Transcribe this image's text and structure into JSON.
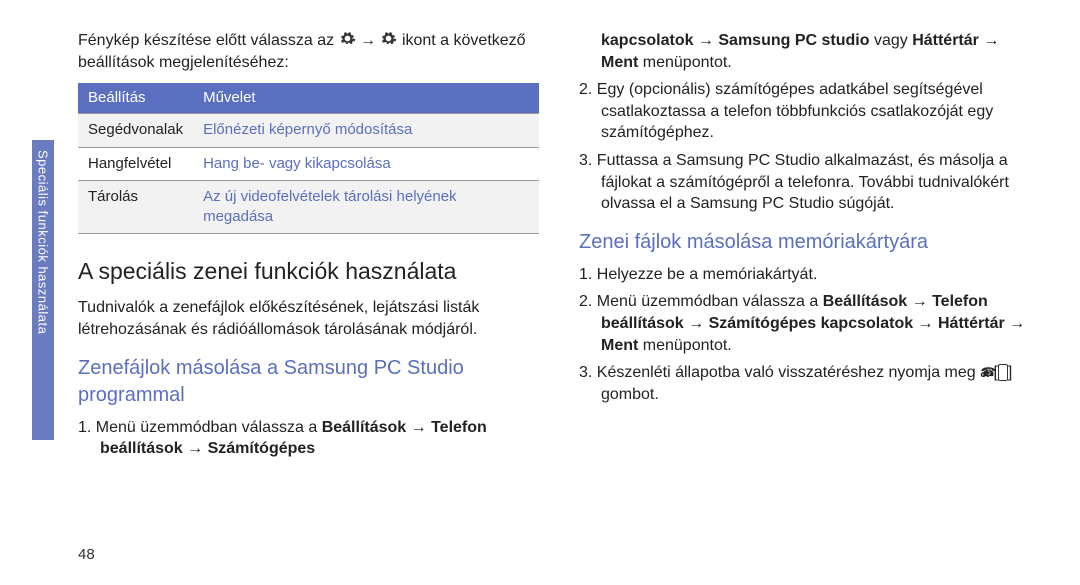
{
  "side_tab": "Speciális funkciók használata",
  "left": {
    "intro_pre": "Fénykép készítése előtt válassza az ",
    "intro_mid": " → ",
    "intro_post": " ikont a következő beállítások megjelenítéséhez:",
    "table": {
      "head_setting": "Beállítás",
      "head_op": "Művelet",
      "rows": [
        {
          "s": "Segédvonalak",
          "o": "Előnézeti képernyő módosítása"
        },
        {
          "s": "Hangfelvétel",
          "o": "Hang be- vagy kikapcsolása"
        },
        {
          "s": "Tárolás",
          "o": "Az új videofelvételek tárolási helyének megadása"
        }
      ]
    },
    "h1": "A speciális zenei funkciók használata",
    "h1_body": "Tudnivalók a zenefájlok előkészítésének, lejátszási listák létrehozásának és rádióállomások tárolásának módjáról.",
    "h2": "Zenefájlok másolása a Samsung PC Studio programmal",
    "step1_a": "Menü üzemmódban válassza a ",
    "step1_b": "Beállítások → Telefon beállítások → Számítógépes "
  },
  "right": {
    "cont_b": "kapcsolatok → Samsung PC studio",
    "cont_mid": " vagy ",
    "cont_b2": "Háttértár → Ment",
    "cont_end": " menüpontot.",
    "step2": "Egy (opcionális) számítógépes adatkábel segítségével csatlakoztassa a telefon többfunkciós csatlakozóját egy számítógéphez.",
    "step3": "Futtassa a Samsung PC Studio alkalmazást, és másolja a fájlokat a számítógépről a telefonra. További tudnivalókért olvassa el a Samsung PC Studio súgóját.",
    "h2": "Zenei fájlok másolása memóriakártyára",
    "s1": "Helyezze be a memóriakártyát.",
    "s2_a": "Menü üzemmódban válassza a ",
    "s2_b": "Beállítások → Telefon beállítások → Számítógépes kapcsolatok → Háttértár → Ment",
    "s2_c": " menüpontot.",
    "s3_a": "Készenléti állapotba való visszatéréshez nyomja meg a [",
    "s3_key": "☎",
    "s3_b": "] gombot."
  },
  "page_number": "48"
}
